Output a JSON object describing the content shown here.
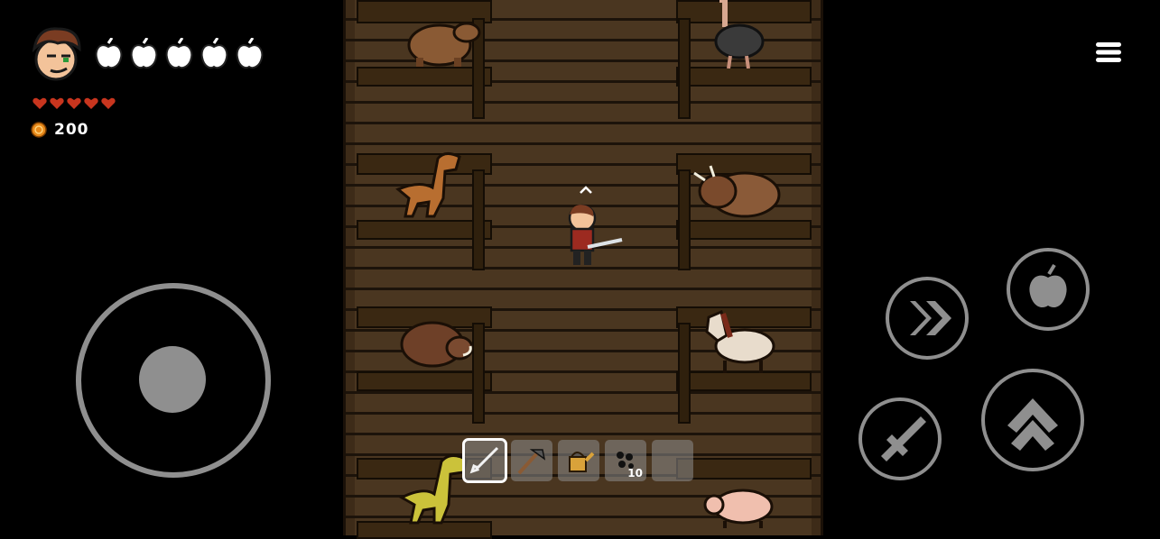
{
  "hud": {
    "coin_count": "200",
    "apples_count": 5,
    "hearts_count": 5,
    "colors": {
      "apple": "#ffffff",
      "heart": "#c8351e",
      "coin": "#e8891a"
    }
  },
  "hotbar": {
    "selected": 0,
    "slots": [
      {
        "icon": "sword-icon",
        "count": ""
      },
      {
        "icon": "hoe-icon",
        "count": ""
      },
      {
        "icon": "watering-can-icon",
        "count": ""
      },
      {
        "icon": "seeds-icon",
        "count": "10"
      },
      {
        "icon": "empty-slot",
        "count": ""
      }
    ]
  },
  "controls": [
    "joystick",
    "dash-button",
    "eat-apple-button",
    "attack-button",
    "jump-button"
  ],
  "animals_left": [
    "capybara",
    "dinosaur",
    "boar",
    "dinosaur"
  ],
  "animals_right": [
    "ostrich",
    "triceratops",
    "horse",
    "pig"
  ]
}
